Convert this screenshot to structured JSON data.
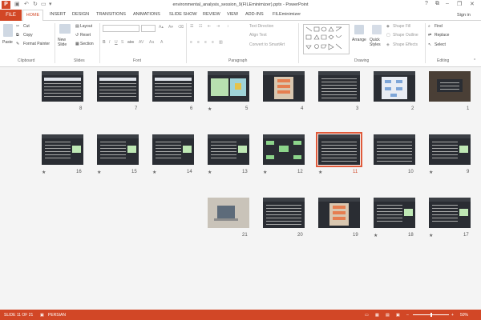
{
  "window": {
    "title": "environmental_analysis_session_9(FILEminimizer).pptx - PowerPoint",
    "help": "?",
    "signin": "Sign in",
    "minimize": "–",
    "restore": "❐",
    "close": "✕"
  },
  "tabs": [
    "FILE",
    "HOME",
    "INSERT",
    "DESIGN",
    "TRANSITIONS",
    "ANIMATIONS",
    "SLIDE SHOW",
    "REVIEW",
    "VIEW",
    "ADD-INS",
    "FILEminimizer"
  ],
  "ribbon": {
    "clipboard": {
      "paste": "Paste",
      "cut": "Cut",
      "copy": "Copy",
      "format_painter": "Format Painter",
      "label": "Clipboard"
    },
    "slides": {
      "new_slide": "New Slide",
      "layout": "Layout",
      "reset": "Reset",
      "section": "Section",
      "label": "Slides"
    },
    "font": {
      "label": "Font"
    },
    "paragraph": {
      "text_direction": "Text Direction",
      "align_text": "Align Text",
      "convert": "Convert to SmartArt",
      "label": "Paragraph"
    },
    "drawing": {
      "arrange": "Arrange",
      "quick_styles": "Quick Styles",
      "shape_fill": "Shape Fill",
      "shape_outline": "Shape Outline",
      "shape_effects": "Shape Effects",
      "label": "Drawing"
    },
    "editing": {
      "find": "Find",
      "replace": "Replace",
      "select": "Select",
      "label": "Editing"
    }
  },
  "slides": [
    {
      "num": "1",
      "star": false,
      "kind": "title"
    },
    {
      "num": "2",
      "star": false,
      "kind": "diagram"
    },
    {
      "num": "3",
      "star": false,
      "kind": "text"
    },
    {
      "num": "4",
      "star": false,
      "kind": "flow"
    },
    {
      "num": "5",
      "star": true,
      "kind": "green"
    },
    {
      "num": "6",
      "star": false,
      "kind": "table"
    },
    {
      "num": "7",
      "star": false,
      "kind": "table"
    },
    {
      "num": "8",
      "star": false,
      "kind": "table"
    },
    {
      "num": "9",
      "star": true,
      "kind": "textbox"
    },
    {
      "num": "10",
      "star": false,
      "kind": "text"
    },
    {
      "num": "11",
      "star": true,
      "kind": "text",
      "selected": true
    },
    {
      "num": "12",
      "star": true,
      "kind": "network"
    },
    {
      "num": "13",
      "star": true,
      "kind": "textbox"
    },
    {
      "num": "14",
      "star": true,
      "kind": "textbox"
    },
    {
      "num": "15",
      "star": true,
      "kind": "textbox"
    },
    {
      "num": "16",
      "star": true,
      "kind": "textbox"
    },
    {
      "num": "17",
      "star": true,
      "kind": "textbox"
    },
    {
      "num": "18",
      "star": true,
      "kind": "textbox"
    },
    {
      "num": "19",
      "star": false,
      "kind": "flow"
    },
    {
      "num": "20",
      "star": false,
      "kind": "text"
    },
    {
      "num": "21",
      "star": false,
      "kind": "photo"
    }
  ],
  "status": {
    "slide": "SLIDE 11 OF 21",
    "language": "PERSIAN",
    "zoom": "50%",
    "minus": "–",
    "plus": "+"
  }
}
